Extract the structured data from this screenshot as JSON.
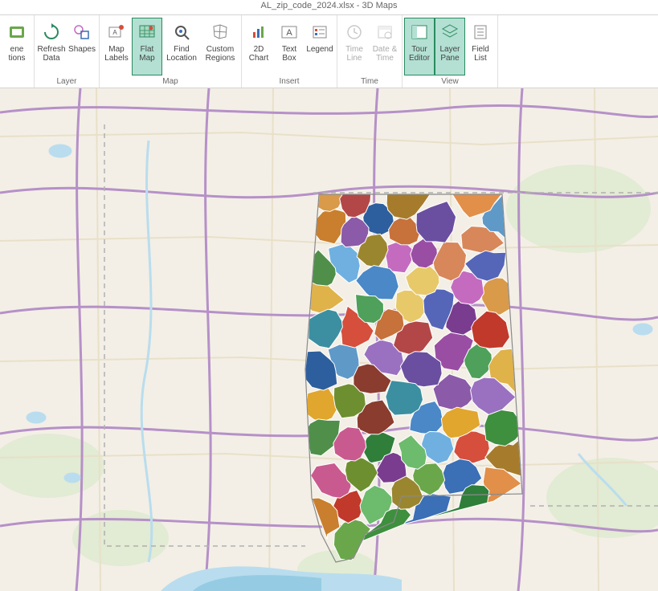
{
  "window": {
    "title": "AL_zip_code_2024.xlsx - 3D Maps"
  },
  "ribbon": {
    "groups": [
      {
        "label": "",
        "buttons": [
          {
            "id": "scene-options",
            "label": "ene\ntions",
            "icon": "scene",
            "active": false,
            "disabled": false,
            "partial": true
          }
        ]
      },
      {
        "label": "Layer",
        "buttons": [
          {
            "id": "refresh-data",
            "label": "Refresh\nData",
            "icon": "refresh",
            "active": false,
            "disabled": false
          },
          {
            "id": "shapes",
            "label": "Shapes",
            "icon": "shapes",
            "active": false,
            "disabled": false,
            "dropdown": true
          }
        ]
      },
      {
        "label": "Map",
        "buttons": [
          {
            "id": "map-labels",
            "label": "Map\nLabels",
            "icon": "maplabels",
            "active": false,
            "disabled": false
          },
          {
            "id": "flat-map",
            "label": "Flat\nMap",
            "icon": "flatmap",
            "active": true,
            "disabled": false
          },
          {
            "id": "find-location",
            "label": "Find\nLocation",
            "icon": "findloc",
            "active": false,
            "disabled": false
          },
          {
            "id": "custom-regions",
            "label": "Custom\nRegions",
            "icon": "regions",
            "active": false,
            "disabled": false
          }
        ]
      },
      {
        "label": "Insert",
        "buttons": [
          {
            "id": "2d-chart",
            "label": "2D\nChart",
            "icon": "chart2d",
            "active": false,
            "disabled": false
          },
          {
            "id": "text-box",
            "label": "Text\nBox",
            "icon": "textbox",
            "active": false,
            "disabled": false
          },
          {
            "id": "legend",
            "label": "Legend",
            "icon": "legend",
            "active": false,
            "disabled": false
          }
        ]
      },
      {
        "label": "Time",
        "buttons": [
          {
            "id": "time-line",
            "label": "Time\nLine",
            "icon": "timeline",
            "active": false,
            "disabled": true
          },
          {
            "id": "date-time",
            "label": "Date &\nTime",
            "icon": "datetime",
            "active": false,
            "disabled": true
          }
        ]
      },
      {
        "label": "View",
        "buttons": [
          {
            "id": "tour-editor",
            "label": "Tour\nEditor",
            "icon": "toureditor",
            "active": true,
            "disabled": false
          },
          {
            "id": "layer-pane",
            "label": "Layer\nPane",
            "icon": "layerpane",
            "active": true,
            "disabled": false
          },
          {
            "id": "field-list",
            "label": "Field\nList",
            "icon": "fieldlist",
            "active": false,
            "disabled": false
          }
        ]
      }
    ]
  },
  "map": {
    "description": "Choropleth / region map of Alabama counties over light street basemap",
    "basemap_colors": {
      "land": "#f3efe6",
      "green": "#e2ebd3",
      "water": "#b9ddee",
      "road_major": "#b690c8",
      "road_minor": "#e6dfc8",
      "state_border": "#b0b0b0"
    },
    "region_palette": [
      "#3b6fb6",
      "#6aa74a",
      "#8b5aa8",
      "#e1a62e",
      "#d64e3c",
      "#2f7e3a",
      "#a67c2c",
      "#6fb0e0",
      "#c46bbf",
      "#e7c96a",
      "#4f8f4a",
      "#9a4ea3",
      "#d8875a",
      "#5f99c8",
      "#c1392b",
      "#7a3c8f",
      "#e0b24a",
      "#3e8f3e",
      "#5566b8",
      "#c97f2e",
      "#6dbb6d",
      "#8a3c2e",
      "#4a88c7",
      "#9a71c0",
      "#d99a4a",
      "#2d5f9e",
      "#b34747",
      "#6e8f2f",
      "#c7713b",
      "#4fa05a",
      "#9b8630",
      "#6a4fa0",
      "#e28f4a",
      "#3c8fa0",
      "#c95a8f"
    ],
    "state": "Alabama",
    "region_type": "zip_code_areas",
    "region_count_approx": 70
  }
}
